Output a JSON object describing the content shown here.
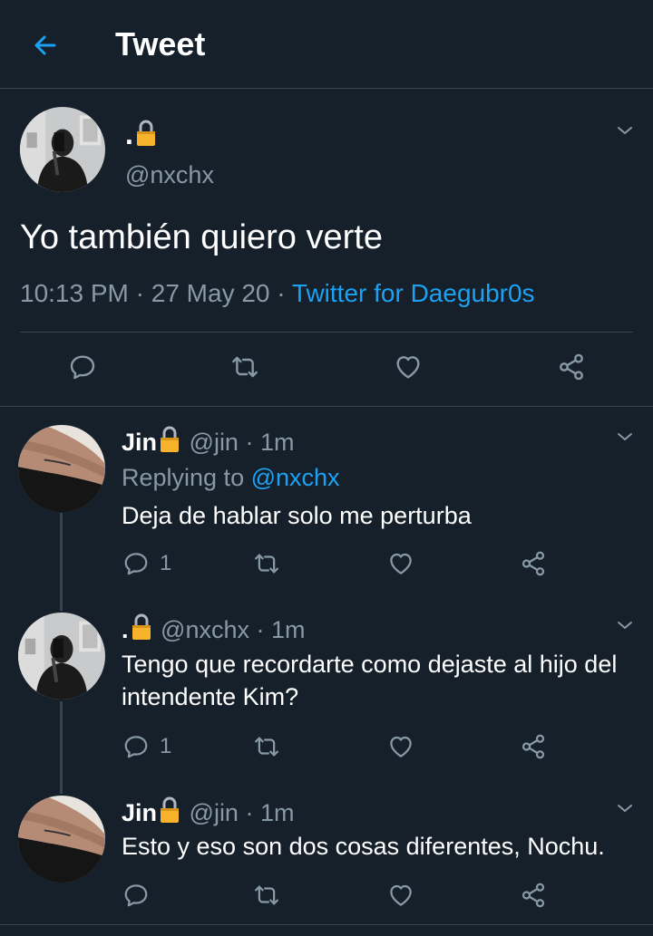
{
  "header": {
    "title": "Tweet"
  },
  "main_tweet": {
    "name": ".",
    "handle": "@nxchx",
    "text": "Yo también quiero verte",
    "time": "10:13 PM",
    "sep1": "·",
    "date": "27 May 20",
    "sep2": "·",
    "client": "Twitter for Daegubr0s"
  },
  "replies": [
    {
      "name": "Jin",
      "handle": "@jin",
      "time": "· 1m",
      "replying_label": "Replying to",
      "replying_to": "@nxchx",
      "text": "Deja de hablar solo me perturba",
      "reply_count": "1"
    },
    {
      "name": ".",
      "handle": "@nxchx",
      "time": "· 1m",
      "text": "Tengo que recordarte como dejaste al hijo del intendente Kim?",
      "reply_count": "1"
    },
    {
      "name": "Jin",
      "handle": "@jin",
      "time": "· 1m",
      "text": "Esto y eso son dos cosas diferentes, Nochu.",
      "reply_count": ""
    }
  ],
  "colors": {
    "background": "#15202b",
    "accent": "#1da1f2",
    "secondary_text": "#8899a6",
    "divider": "#38444d"
  }
}
